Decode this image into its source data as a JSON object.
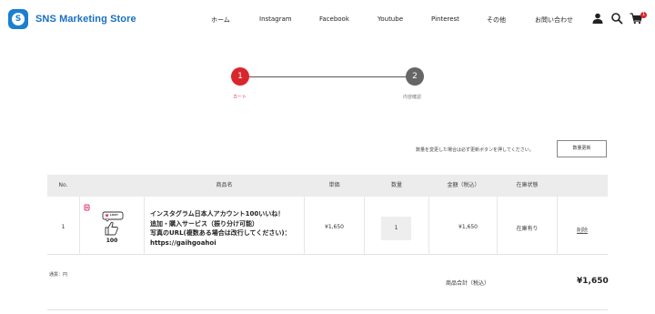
{
  "header": {
    "logo_text": "SNS Marketing Store",
    "logo_letter": "S",
    "nav": [
      "ホーム",
      "Instagram",
      "Facebook",
      "Youtube",
      "Pinterest",
      "その他",
      "お問い合わせ"
    ],
    "icons": [
      "user-icon",
      "search-icon",
      "cart-icon"
    ],
    "cart_count": "1"
  },
  "steps": [
    {
      "number": "1",
      "label": "カート",
      "active": true
    },
    {
      "number": "2",
      "label": "内容確認",
      "active": false
    }
  ],
  "cart": {
    "notice": "数量を変更した場合は必ず更新ボタンを押してください。",
    "update_button": "数量更新",
    "columns": [
      "No.",
      "商品名",
      "単価",
      "数量",
      "金額（税込）",
      "在庫状態"
    ],
    "items": [
      {
        "no": "1",
        "thumb_label": "100",
        "thumb_badge": "LIKE!",
        "name_lines": [
          "インスタグラム日本人アカウント100いいね！",
          "追加・購入サービス（振り分け可能）",
          "写真のURL(複数ある場合は改行してください)：",
          "https://gaihgoahoi"
        ],
        "unit_price": "¥1,650",
        "quantity": "1",
        "amount": "¥1,650",
        "stock": "在庫有り",
        "delete": "削除"
      }
    ],
    "currency_note": "通貨：円",
    "subtotal_label": "商品合計（税込）",
    "subtotal_value": "¥1,650"
  },
  "colors": {
    "brand": "#1b7fd0",
    "active_step": "#d9262c",
    "inactive_step": "#666666"
  }
}
